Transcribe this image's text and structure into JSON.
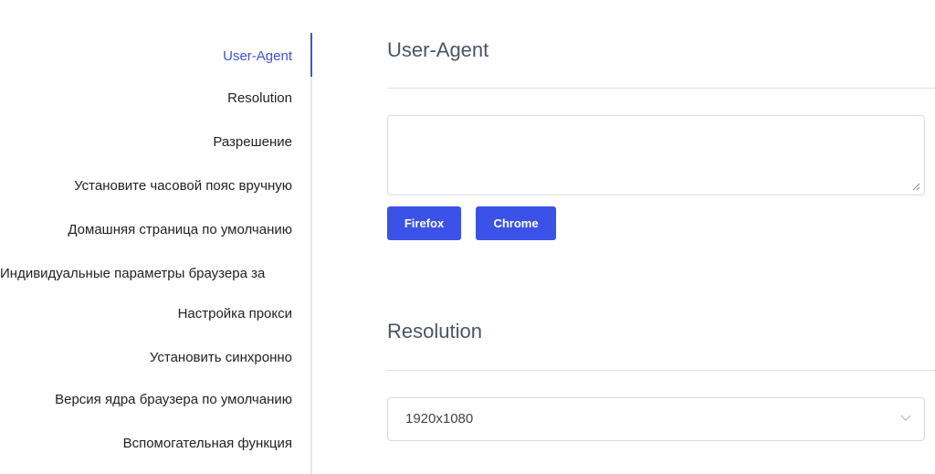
{
  "sidebar": {
    "items": [
      {
        "label": "User-Agent"
      },
      {
        "label": "Resolution"
      },
      {
        "label": "Разрешение"
      },
      {
        "label": "Установите часовой пояс вручную"
      },
      {
        "label": "Домашняя страница по умолчанию"
      },
      {
        "label": "Индивидуальные параметры браузера за"
      },
      {
        "label": "Настройка прокси"
      },
      {
        "label": "Установить синхронно"
      },
      {
        "label": "Версия ядра браузера по умолчанию"
      },
      {
        "label": "Вспомогательная функция"
      }
    ],
    "active_color": "#3b52e8"
  },
  "sections": {
    "user_agent": {
      "title": "User-Agent",
      "textarea_value": "",
      "buttons": {
        "firefox": "Firefox",
        "chrome": "Chrome"
      }
    },
    "resolution": {
      "title": "Resolution",
      "selected": "1920x1080"
    }
  },
  "icons": {
    "resize": "resize-handle-icon",
    "dropdown": "chevron-down-icon"
  },
  "colors": {
    "accent": "#3b52e8",
    "border": "#d9dce1",
    "divider": "#dcdfe4"
  }
}
